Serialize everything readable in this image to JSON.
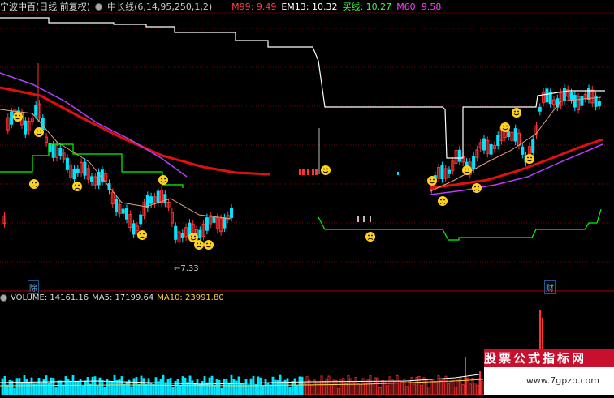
{
  "header": {
    "security_name": "宁波中百(日线 前复权)",
    "indicator_title": "中长线(6,14,95,250,1,2)",
    "m99_label": "M99: 9.49",
    "em13_label": "EM13: 10.32",
    "buy_line_label": "买线: 10.27",
    "m60_label": "M60: 9.58"
  },
  "price_marker": "7.33",
  "event_tags": [
    "除",
    "财"
  ],
  "volume_header": {
    "volume_label": "VOLUME: 14161.16",
    "ma5_label": "MA5: 17199.64",
    "ma10_label": "MA10: 23991.80"
  },
  "watermark": {
    "brand": "股票公式指标网",
    "url": "www.7gpzb.com"
  },
  "colors": {
    "background": "#000000",
    "grid": "#7a0000",
    "up": "#ff3333",
    "down": "#00e5ff",
    "m99": "#ff3333",
    "em13": "#ffffff",
    "buy_line": "#00ff00",
    "m60": "#ff00ff",
    "red_line": "#e01010",
    "magenta_line": "#b040ff"
  },
  "icons": [
    "settings-icon",
    "smiley-icon",
    "sad-face-icon"
  ]
}
